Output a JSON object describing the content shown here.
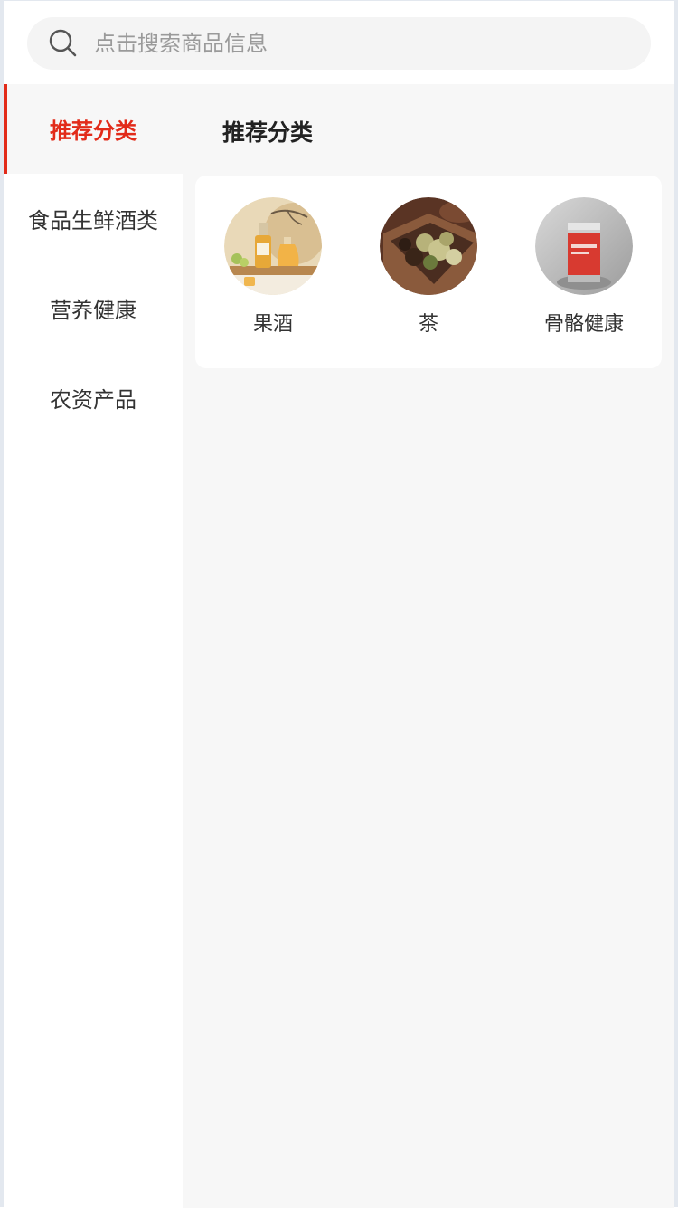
{
  "search": {
    "placeholder": "点击搜索商品信息",
    "icon": "search-icon"
  },
  "sidebar": {
    "items": [
      {
        "label": "推荐分类",
        "active": true
      },
      {
        "label": "食品生鲜酒类",
        "active": false
      },
      {
        "label": "营养健康",
        "active": false
      },
      {
        "label": "农资产品",
        "active": false
      }
    ]
  },
  "main": {
    "section_title": "推荐分类",
    "categories": [
      {
        "label": "果酒",
        "image": "fruit-wine-photo"
      },
      {
        "label": "茶",
        "image": "tea-photo"
      },
      {
        "label": "骨骼健康",
        "image": "bone-health-product-photo"
      }
    ]
  },
  "colors": {
    "accent": "#e22b1a",
    "background": "#f7f7f7",
    "text": "#333333",
    "placeholder": "#9a9a9a"
  }
}
